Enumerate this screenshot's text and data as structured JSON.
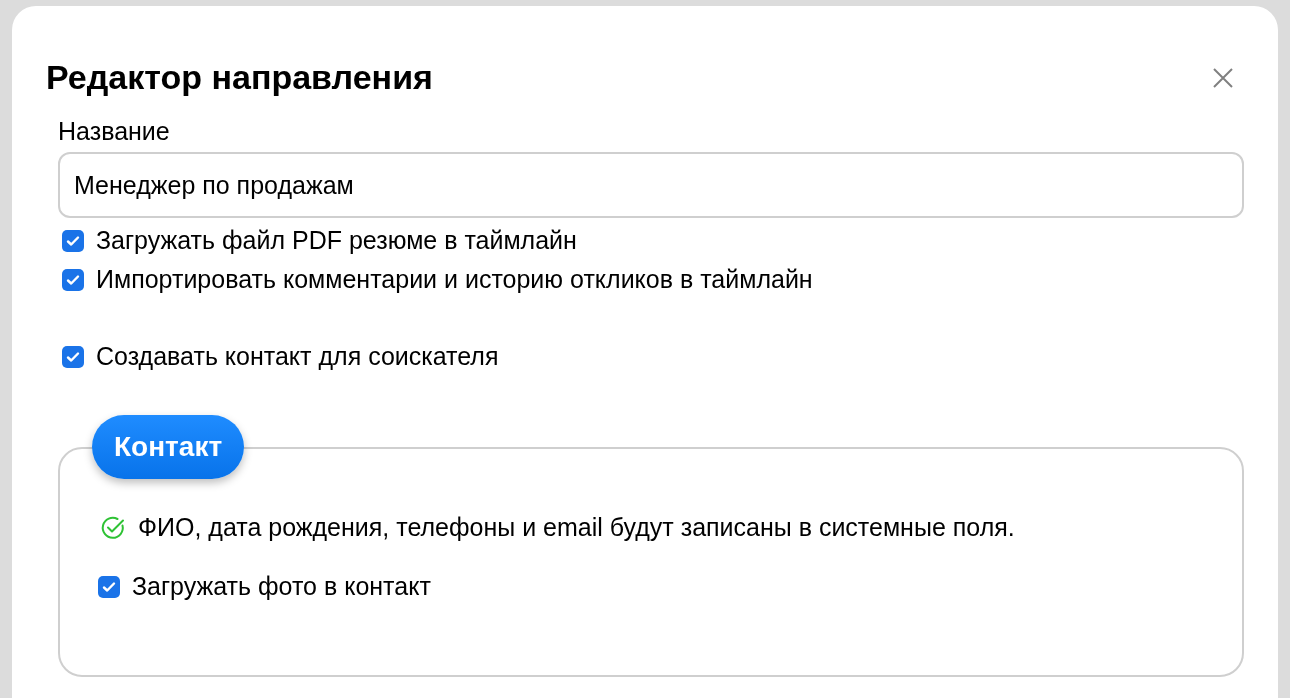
{
  "dialog": {
    "title": "Редактор направления",
    "name_field": {
      "label": "Название",
      "value": "Менеджер по продажам"
    },
    "options": [
      {
        "label": "Загружать файл PDF резюме в таймлайн",
        "checked": true
      },
      {
        "label": "Импортировать комментарии и историю откликов в таймлайн",
        "checked": true
      }
    ],
    "contact_option": {
      "label": "Создавать контакт для соискателя",
      "checked": true
    },
    "contact_section": {
      "title": "Контакт",
      "note": "ФИО, дата рождения, телефоны и email будут записаны в системные поля.",
      "photo_option": {
        "label": "Загружать фото в контакт",
        "checked": true
      }
    }
  }
}
